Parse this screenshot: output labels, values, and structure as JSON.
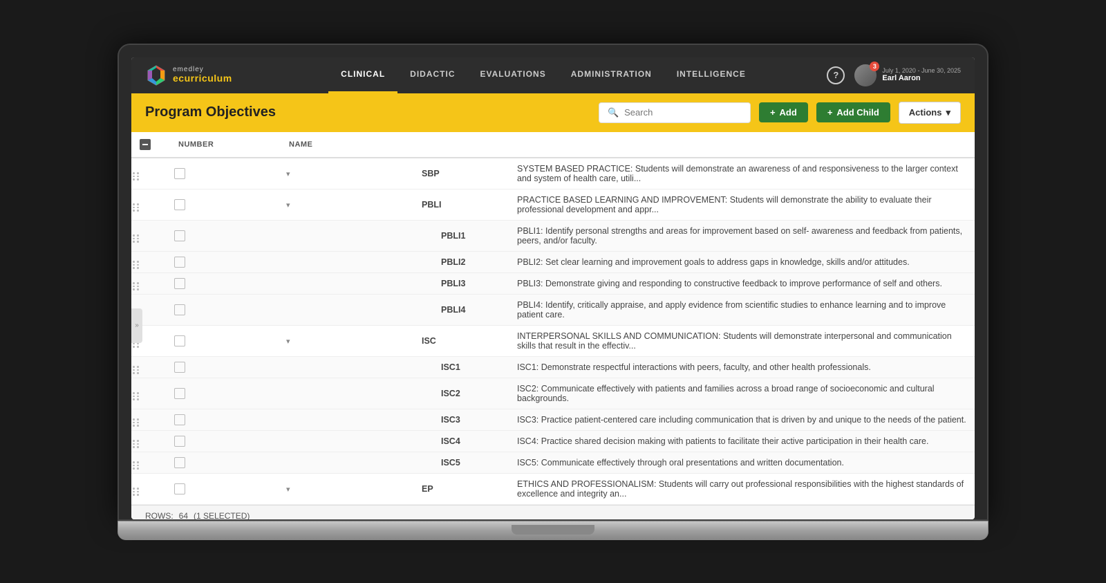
{
  "brand": {
    "top": "emedley",
    "bottom": "ecurriculum"
  },
  "nav": {
    "links": [
      {
        "label": "CLINICAL",
        "active": true
      },
      {
        "label": "DIDACTIC",
        "active": false
      },
      {
        "label": "EVALUATIONS",
        "active": false
      },
      {
        "label": "ADMINISTRATION",
        "active": false
      },
      {
        "label": "INTELLIGENCE",
        "active": false
      }
    ]
  },
  "user": {
    "date": "July 1, 2020 - June 30, 2025",
    "name": "Earl Aaron",
    "badge": "3"
  },
  "header": {
    "title": "Program Objectives",
    "search_placeholder": "Search",
    "add_label": "+ Add",
    "add_child_label": "+ Add Child",
    "actions_label": "Actions"
  },
  "table": {
    "columns": [
      {
        "key": "number",
        "label": "NUMBER"
      },
      {
        "key": "name",
        "label": "NAME"
      }
    ],
    "rows": [
      {
        "id": 1,
        "number": "SBP",
        "name": "SYSTEM BASED PRACTICE: Students will demonstrate an awareness of and responsiveness to the larger context and system of health care, utili...",
        "level": 0,
        "expandable": true,
        "checked": false
      },
      {
        "id": 2,
        "number": "PBLI",
        "name": "PRACTICE BASED LEARNING AND IMPROVEMENT: Students will demonstrate the ability to evaluate their professional development and appr...",
        "level": 0,
        "expandable": true,
        "checked": false
      },
      {
        "id": 3,
        "number": "PBLI1",
        "name": "PBLI1: Identify personal strengths and areas for improvement based on self- awareness and feedback from patients, peers, and/or faculty.",
        "level": 1,
        "expandable": false,
        "checked": false
      },
      {
        "id": 4,
        "number": "PBLI2",
        "name": "PBLI2: Set clear learning and improvement goals to address gaps in knowledge, skills and/or attitudes.",
        "level": 1,
        "expandable": false,
        "checked": false
      },
      {
        "id": 5,
        "number": "PBLI3",
        "name": "PBLI3: Demonstrate giving and responding to constructive feedback to improve performance of self and others.",
        "level": 1,
        "expandable": false,
        "checked": false
      },
      {
        "id": 6,
        "number": "PBLI4",
        "name": "PBLI4: Identify, critically appraise, and apply evidence from scientific studies to enhance learning and to improve patient care.",
        "level": 1,
        "expandable": false,
        "checked": false
      },
      {
        "id": 7,
        "number": "ISC",
        "name": "INTERPERSONAL SKILLS AND COMMUNICATION: Students will demonstrate interpersonal and communication skills that result in the effectiv...",
        "level": 0,
        "expandable": true,
        "checked": false
      },
      {
        "id": 8,
        "number": "ISC1",
        "name": "ISC1: Demonstrate respectful interactions with peers, faculty, and other health professionals.",
        "level": 1,
        "expandable": false,
        "checked": false
      },
      {
        "id": 9,
        "number": "ISC2",
        "name": "ISC2: Communicate effectively with patients and families across a broad range of socioeconomic and cultural backgrounds.",
        "level": 1,
        "expandable": false,
        "checked": false
      },
      {
        "id": 10,
        "number": "ISC3",
        "name": "ISC3: Practice patient-centered care including communication that is driven by and unique to the needs of the patient.",
        "level": 1,
        "expandable": false,
        "checked": false
      },
      {
        "id": 11,
        "number": "ISC4",
        "name": "ISC4: Practice shared decision making with patients to facilitate their active participation in their health care.",
        "level": 1,
        "expandable": false,
        "checked": false
      },
      {
        "id": 12,
        "number": "ISC5",
        "name": "ISC5: Communicate effectively through oral presentations and written documentation.",
        "level": 1,
        "expandable": false,
        "checked": false
      },
      {
        "id": 13,
        "number": "EP",
        "name": "ETHICS AND PROFESSIONALISM: Students will carry out professional responsibilities with the highest standards of excellence and integrity an...",
        "level": 0,
        "expandable": true,
        "checked": false
      }
    ]
  },
  "footer": {
    "rows_label": "ROWS:",
    "rows_count": "64",
    "selected_label": "(1 SELECTED)"
  }
}
